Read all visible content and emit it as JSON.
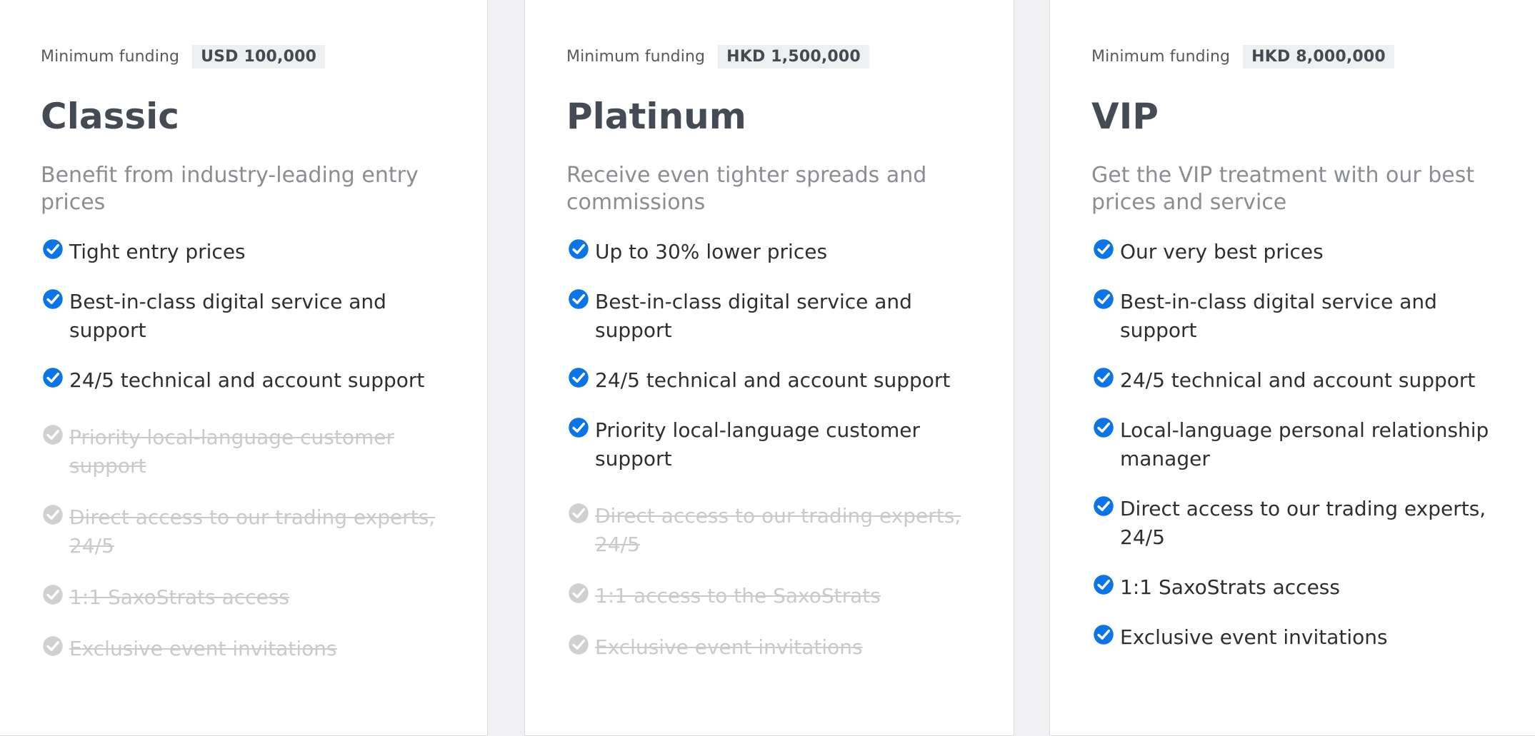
{
  "colors": {
    "check_active": "#0b74e6",
    "check_inactive": "#cfd0d2",
    "title": "#444b55",
    "description": "#8a8d92"
  },
  "plans": [
    {
      "funding_label": "Minimum funding",
      "funding_value": "USD 100,000",
      "title": "Classic",
      "description": "Benefit from industry-leading entry prices",
      "features": [
        {
          "text": "Tight entry prices",
          "included": true
        },
        {
          "text": "Best-in-class digital service and support",
          "included": true
        },
        {
          "text": "24/5 technical and account support",
          "included": true
        },
        {
          "text": "Priority local-language customer support",
          "included": false
        },
        {
          "text": "Direct access to our trading experts, 24/5",
          "included": false
        },
        {
          "text": "1:1 SaxoStrats access",
          "included": false
        },
        {
          "text": "Exclusive event invitations",
          "included": false
        }
      ]
    },
    {
      "funding_label": "Minimum funding",
      "funding_value": "HKD 1,500,000",
      "title": "Platinum",
      "description": "Receive even tighter spreads and commissions",
      "features": [
        {
          "text": "Up to 30% lower prices",
          "included": true
        },
        {
          "text": "Best-in-class digital service and support",
          "included": true
        },
        {
          "text": "24/5 technical and account support",
          "included": true
        },
        {
          "text": "Priority local-language customer support",
          "included": true
        },
        {
          "text": "Direct access to our trading experts, 24/5",
          "included": false
        },
        {
          "text": "1:1 access to the SaxoStrats",
          "included": false
        },
        {
          "text": "Exclusive event invitations",
          "included": false
        }
      ]
    },
    {
      "funding_label": "Minimum funding",
      "funding_value": "HKD 8,000,000",
      "title": "VIP",
      "description": "Get the VIP treatment with our best prices and service",
      "features": [
        {
          "text": "Our very best prices",
          "included": true
        },
        {
          "text": "Best-in-class digital service and support",
          "included": true
        },
        {
          "text": "24/5 technical and account support",
          "included": true
        },
        {
          "text": "Local-language personal relationship manager",
          "included": true
        },
        {
          "text": "Direct access to our trading experts, 24/5",
          "included": true
        },
        {
          "text": "1:1 SaxoStrats access",
          "included": true
        },
        {
          "text": "Exclusive event invitations",
          "included": true
        }
      ]
    }
  ]
}
